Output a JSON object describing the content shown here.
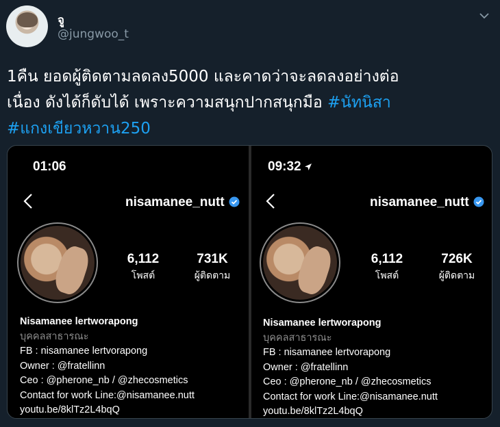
{
  "tweet": {
    "display_name": "จู",
    "handle": "@jungwoo_t",
    "text_line1": "1คืน ยอดผู้ติดตามลดลง5000 และคาดว่าจะลดลงอย่างต่อ",
    "text_line2": "เนื่อง ดังได้ก็ดับได้ เพราะความสนุกปากสนุกมือ ",
    "hashtag1": "#นัทนิสา",
    "hashtag2": "#แกงเขียวหวาน250"
  },
  "screenshots": [
    {
      "time": "01:06",
      "username": "nisamanee_nutt",
      "posts_value": "6,112",
      "posts_label": "โพสต์",
      "followers_value": "731K",
      "followers_label": "ผู้ติดตาม",
      "bio": {
        "name": "Nisamanee lertworapong",
        "category": "บุคคลสาธารณะ",
        "line1": "FB : nisamanee lertvorapong",
        "line2": "Owner : @fratellinn",
        "line3": "Ceo : @pherone_nb / @zhecosmetics",
        "line4": "Contact for work Line:@nisamanee.nutt",
        "line5": "youtu.be/8klTz2L4bqQ"
      }
    },
    {
      "time": "09:32",
      "username": "nisamanee_nutt",
      "posts_value": "6,112",
      "posts_label": "โพสต์",
      "followers_value": "726K",
      "followers_label": "ผู้ติดตาม",
      "bio": {
        "name": "Nisamanee lertworapong",
        "category": "บุคคลสาธารณะ",
        "line1": "FB : nisamanee lertvorapong",
        "line2": "Owner : @fratellinn",
        "line3": "Ceo : @pherone_nb / @zhecosmetics",
        "line4": "Contact for work Line:@nisamanee.nutt",
        "line5": "youtu.be/8klTz2L4bqQ"
      }
    }
  ],
  "icons": {
    "avatar": "user-avatar",
    "menu": "chevron-down-icon",
    "back": "back-arrow-icon",
    "verified": "verified-badge-icon",
    "location": "location-arrow-icon"
  },
  "colors": {
    "background": "#15202b",
    "hashtag": "#1da1f2",
    "verified": "#3897f0",
    "muted": "#8899a6"
  }
}
